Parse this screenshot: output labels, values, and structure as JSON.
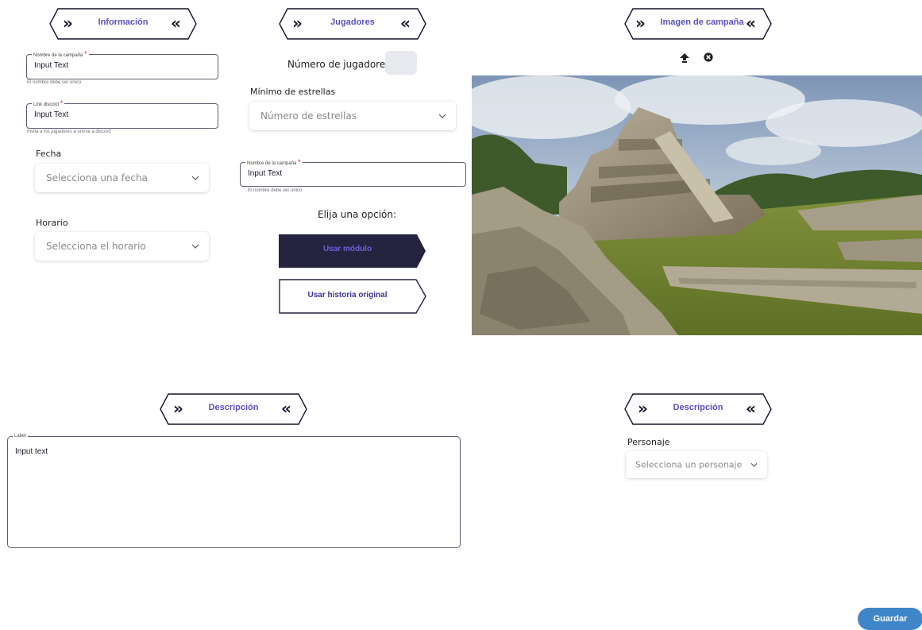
{
  "sections": {
    "informacion": "Información",
    "jugadores": "Jugadores",
    "imagen": "Imagen de campaña",
    "descripcion_left": "Descripción",
    "descripcion_right": "Descripción"
  },
  "info": {
    "name_field": {
      "label": "Nombre de la campaña",
      "value": "Input Text",
      "helper": "El nombre debe ser único"
    },
    "discord_field": {
      "label": "Link discord",
      "value": "Input Text",
      "helper": "Invita a los jugadores a unirse a discord"
    },
    "fecha": {
      "label": "Fecha",
      "placeholder": "Selecciona una fecha"
    },
    "horario": {
      "label": "Horario",
      "placeholder": "Selecciona el horario"
    }
  },
  "players": {
    "count_label": "Número de jugadores",
    "min_stars_label": "Mínimo de estrellas",
    "stars_placeholder": "Número de estrellas",
    "name_field": {
      "label": "Nombre de la campaña",
      "value": "Input Text",
      "helper": "El nombre debe ser único"
    },
    "choose_label": "Elija una opción:",
    "use_module": "Usar módulo",
    "use_original": "Usar historia original"
  },
  "description": {
    "label": "Label",
    "value": "Input text"
  },
  "character": {
    "label": "Personaje",
    "placeholder": "Selecciona un personaje"
  },
  "save_label": "Guardar",
  "colors": {
    "accent": "#5a4fc0",
    "dark_button": "#242440",
    "save_button": "#3f86c8",
    "required": "#e0282e"
  },
  "icons": {
    "upload": "upload-icon",
    "remove": "remove-circle-icon",
    "chevron": "chevron-down-icon"
  }
}
